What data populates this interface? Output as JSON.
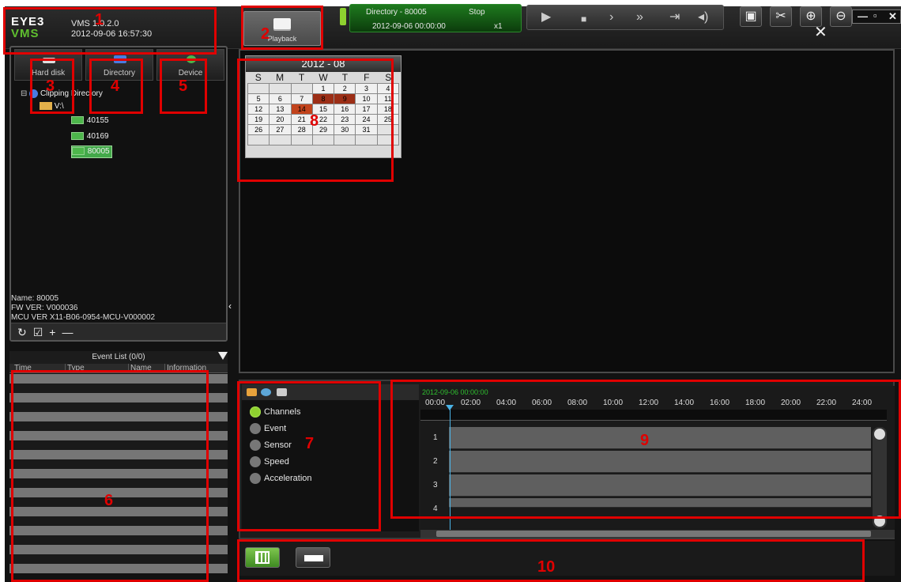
{
  "app": {
    "logo_line1": "EYE3",
    "logo_line2": "VMS",
    "version": "VMS 1.0.2.0",
    "datetime": "2012-09-06 16:57:30",
    "playback_tab": "Playback",
    "window_controls": [
      "—",
      "▫",
      "✕"
    ]
  },
  "left_tabs": [
    {
      "label": "Hard disk",
      "icon": "harddisk-icon"
    },
    {
      "label": "Directory",
      "icon": "folder-icon"
    },
    {
      "label": "Device",
      "icon": "device-icon"
    }
  ],
  "tree": {
    "root": "Clipping Directory",
    "drive": "V:\\",
    "devices": [
      "40155",
      "40169",
      "80005"
    ],
    "selected": "80005"
  },
  "device_info": {
    "name": "Name: 80005",
    "fw": "FW VER: V000036",
    "mcu": "MCU VER X11-B06-0954-MCU-V000002"
  },
  "event_list": {
    "title": "Event List (0/0)",
    "columns": [
      "Time",
      "Type",
      "Name",
      "Information"
    ]
  },
  "calendar": {
    "title": "2012 - 08",
    "weekdays": [
      "S",
      "M",
      "T",
      "W",
      "T",
      "F",
      "S"
    ],
    "days": [
      "",
      "",
      "",
      "1",
      "2",
      "3",
      "4",
      "5",
      "6",
      "7",
      "8",
      "9",
      "10",
      "11",
      "12",
      "13",
      "14",
      "15",
      "16",
      "17",
      "18",
      "19",
      "20",
      "21",
      "22",
      "23",
      "24",
      "25",
      "26",
      "27",
      "28",
      "29",
      "30",
      "31",
      "",
      "",
      "",
      "",
      "",
      "",
      "",
      ""
    ],
    "recorded": [
      "8",
      "9"
    ],
    "selected": "14"
  },
  "filters": [
    "Channels",
    "Event",
    "Sensor",
    "Speed",
    "Acceleration"
  ],
  "timeline": {
    "date": "2012-09-06 00:00:00",
    "ticks": [
      "00:00",
      "02:00",
      "04:00",
      "06:00",
      "08:00",
      "10:00",
      "12:00",
      "14:00",
      "16:00",
      "18:00",
      "20:00",
      "22:00",
      "24:00"
    ],
    "tracks": [
      "1",
      "2",
      "3",
      "4"
    ]
  },
  "status": {
    "source": "Directory - 80005",
    "state": "Stop",
    "time": "2012-09-06 00:00:00",
    "speed": "x1"
  },
  "annotations": [
    "1",
    "2",
    "3",
    "4",
    "5",
    "6",
    "7",
    "8",
    "9",
    "10"
  ],
  "colors": {
    "accent_green": "#8ed12f",
    "record_red": "#9c2e16",
    "cursor_blue": "#4ab3e6",
    "annotation_red": "#e00000"
  }
}
